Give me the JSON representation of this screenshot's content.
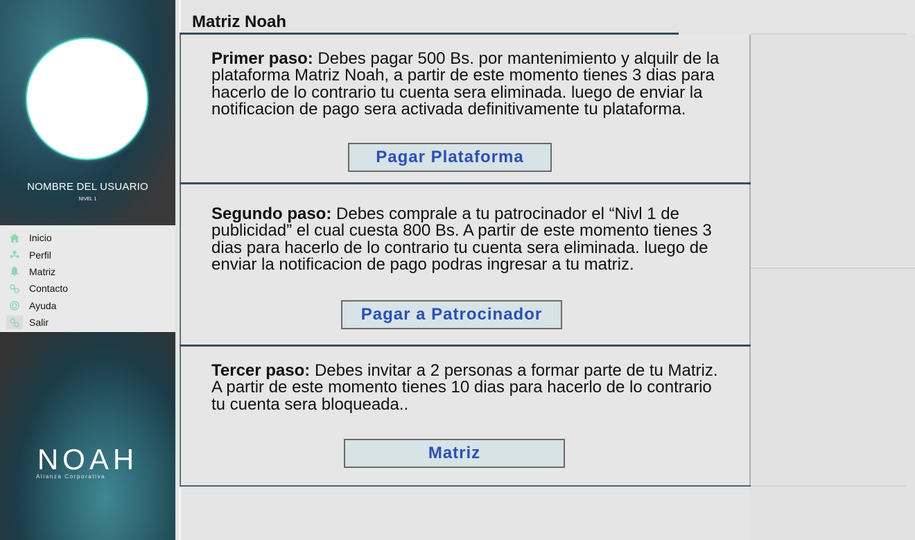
{
  "sidebar": {
    "user_name": "NOMBRE DEL USUARIO",
    "user_level": "NIVEL 1",
    "menu": [
      {
        "label": "Inicio",
        "icon": "home-icon"
      },
      {
        "label": "Perfil",
        "icon": "profile-icon"
      },
      {
        "label": "Matriz",
        "icon": "bell-icon"
      },
      {
        "label": "Contacto",
        "icon": "link-icon"
      },
      {
        "label": "Ayuda",
        "icon": "help-icon"
      },
      {
        "label": "Salir",
        "icon": "link-icon"
      }
    ],
    "logo": "NOAH",
    "logo_sub": "Alianza Corporativa"
  },
  "page": {
    "title": "Matriz Noah"
  },
  "steps": [
    {
      "heading": "Primer paso:",
      "text": " Debes pagar 500 Bs. por mantenimiento y alquilr de la plataforma Matriz Noah, a partir de este momento tienes 3 dias para hacerlo de lo contrario tu cuenta sera eliminada. luego de enviar la notificacion de pago sera activada definitivamente tu plataforma.",
      "button": "Pagar Plataforma"
    },
    {
      "heading": "Segundo paso:",
      "text": " Debes comprale a tu patrocinador el “Nivl 1 de publicidad” el cual cuesta 800 Bs. A partir de este momento tienes 3 dias para hacerlo de lo contrario tu cuenta sera eliminada. luego de enviar la notificacion de pago podras ingresar a tu matriz.",
      "button": "Pagar a Patrocinador"
    },
    {
      "heading": "Tercer paso:",
      "text": " Debes invitar a 2 personas a formar parte de tu Matriz. A partir de este momento tienes 10 dias para hacerlo de lo contrario tu cuenta sera bloqueada..",
      "button": "Matriz"
    }
  ],
  "colors": {
    "button_text": "#2b4fb5",
    "button_bg": "#d7e3e6",
    "divider": "#33505f",
    "menu_icon": "#8fd9b0"
  }
}
